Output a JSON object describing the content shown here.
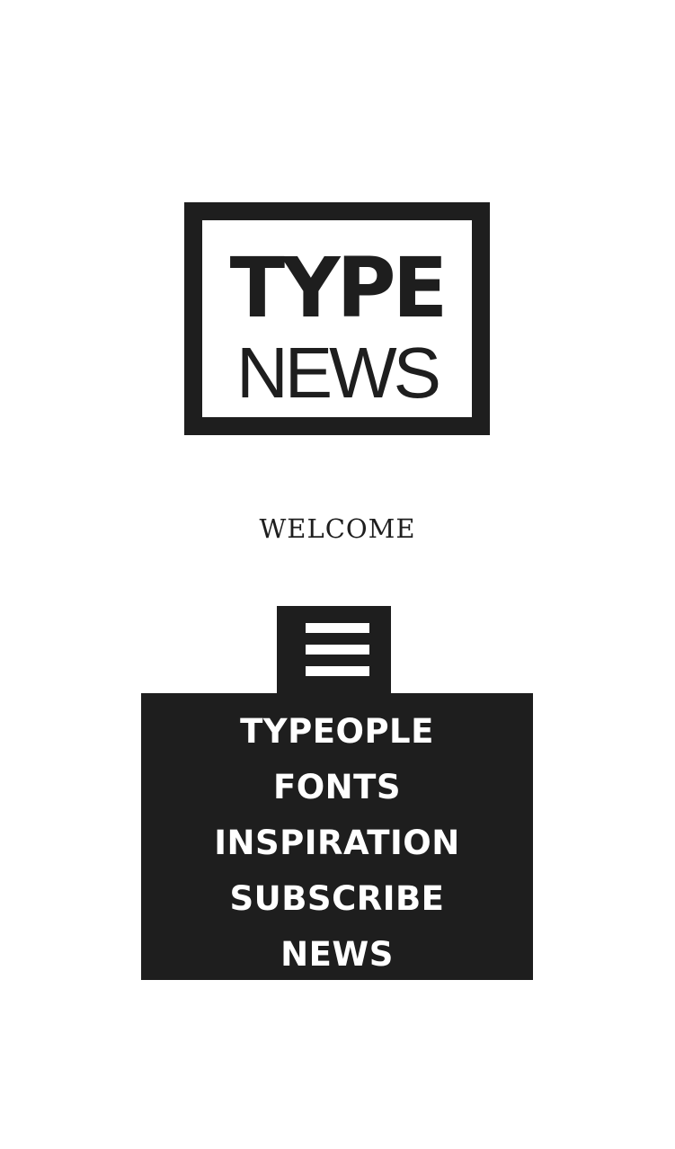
{
  "logo": {
    "line1": "TYPE",
    "line2": "NEWS"
  },
  "welcome": "WELCOME",
  "menu": {
    "toggle_icon": "hamburger-icon",
    "items": [
      {
        "label": "TYPEOPLE"
      },
      {
        "label": "FONTS"
      },
      {
        "label": "INSPIRATION"
      },
      {
        "label": "SUBSCRIBE"
      },
      {
        "label": "NEWS"
      }
    ]
  },
  "colors": {
    "background": "#ffffff",
    "dark": "#1e1e1e",
    "menu_text": "#ffffff"
  }
}
